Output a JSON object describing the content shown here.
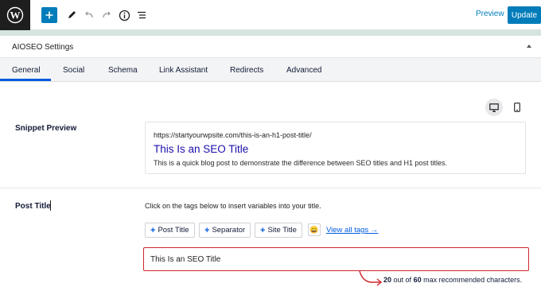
{
  "toolbar": {
    "preview_label": "Preview",
    "update_label": "Update"
  },
  "settings": {
    "title": "AIOSEO Settings"
  },
  "tabs": [
    {
      "label": "General"
    },
    {
      "label": "Social"
    },
    {
      "label": "Schema"
    },
    {
      "label": "Link Assistant"
    },
    {
      "label": "Redirects"
    },
    {
      "label": "Advanced"
    }
  ],
  "snippet_preview": {
    "label": "Snippet Preview",
    "url": "https://startyourwpsite.com/this-is-an-h1-post-title/",
    "title": "This Is an SEO Title",
    "description": "This is a quick blog post to demonstrate the difference between SEO titles and H1 post titles."
  },
  "post_title": {
    "label": "Post Title",
    "instruction": "Click on the tags below to insert variables into your title.",
    "tags": [
      {
        "label": "Post Title"
      },
      {
        "label": "Separator"
      },
      {
        "label": "Site Title"
      }
    ],
    "emoji": "😀",
    "view_all_label": "View all tags →",
    "value": "This Is an SEO Title",
    "count_current": "20",
    "count_out_of": "out of",
    "count_max": "60",
    "count_suffix": "max recommended characters."
  },
  "colors": {
    "accent": "#007cba",
    "link_blue": "#005ae0",
    "serp_title": "#1a0dab",
    "highlight_red": "#d0262c"
  },
  "icons": [
    "wordpress-logo-icon",
    "plus-icon",
    "pencil-icon",
    "undo-icon",
    "redo-icon",
    "info-icon",
    "list-view-icon",
    "chevron-up-icon",
    "desktop-icon",
    "mobile-icon",
    "emoji-icon",
    "red-arrow-icon"
  ]
}
